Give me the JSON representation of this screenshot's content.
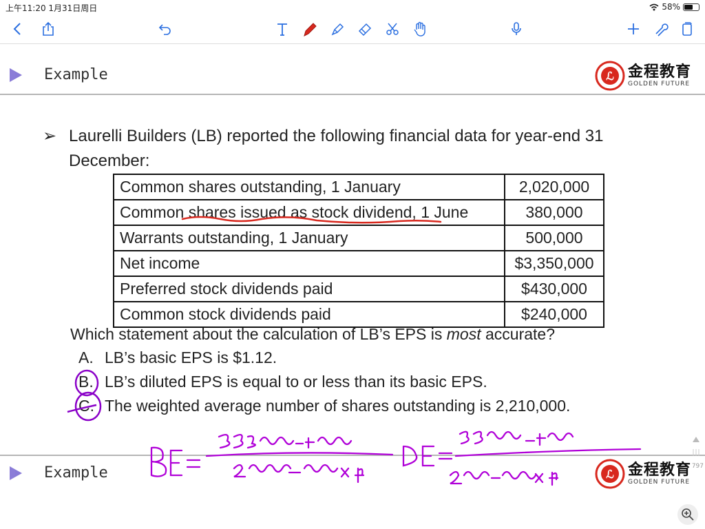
{
  "status": {
    "time": "上午11:20 1月31日周日",
    "battery": "58%",
    "battery_level": 0.58
  },
  "toolbar": {
    "icons": [
      "back-icon",
      "share-icon",
      "undo-icon",
      "text-tool-icon",
      "pen-icon",
      "highlighter-icon",
      "eraser-icon",
      "lasso-icon",
      "hand-icon",
      "microphone-icon",
      "add-icon",
      "wrench-icon",
      "page-icon"
    ],
    "accent": "#2b6fe0"
  },
  "header": {
    "title": "Example",
    "brand_cn": "金程教育",
    "brand_en": "GOLDEN FUTURE"
  },
  "slide": {
    "bullet": "➢",
    "intro": "Laurelli Builders (LB) reported the following financial data for year-end 31 December:",
    "table": [
      {
        "label": "Common shares outstanding, 1 January",
        "value": "2,020,000"
      },
      {
        "label": "Common shares issued as stock dividend, 1 June",
        "value": "380,000"
      },
      {
        "label": "Warrants outstanding, 1 January",
        "value": "500,000"
      },
      {
        "label": "Net income",
        "value": "$3,350,000"
      },
      {
        "label": "Preferred stock dividends paid",
        "value": "$430,000"
      },
      {
        "label": "Common stock dividends paid",
        "value": "$240,000"
      }
    ],
    "question_pre": "Which statement about the calculation of LB’s EPS is ",
    "question_em": "most",
    "question_post": " accurate?",
    "options": [
      {
        "letter": "A.",
        "text": "LB’s basic EPS is $1.12."
      },
      {
        "letter": "B.",
        "text": "LB’s diluted EPS is equal to or less than its basic EPS."
      },
      {
        "letter": "C.",
        "text": "The weighted average number of shares outstanding is 2,210,000."
      }
    ]
  },
  "footer": {
    "page": "797"
  },
  "ink_colors": {
    "red": "#d8281e",
    "purple": "#8a00c8"
  }
}
